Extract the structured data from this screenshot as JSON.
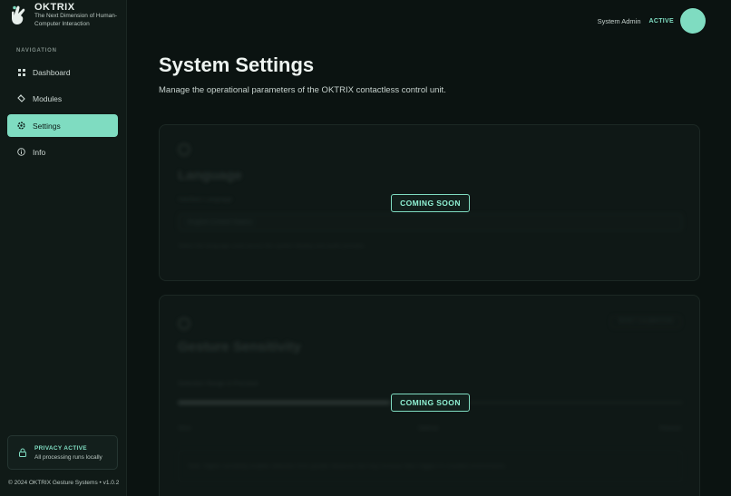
{
  "brand": {
    "name_part1": "OK",
    "name_part2": "TRIX",
    "tagline": "The Next Dimension of Human-Computer Interaction",
    "logo_icon": "hand-icon"
  },
  "sidebar": {
    "heading": "NAVIGATION",
    "items": [
      {
        "label": "Dashboard",
        "icon": "grid-icon",
        "active": false
      },
      {
        "label": "Modules",
        "icon": "puzzle-icon",
        "active": false
      },
      {
        "label": "Settings",
        "icon": "gear-icon",
        "active": true
      },
      {
        "label": "Info",
        "icon": "info-icon",
        "active": false
      }
    ],
    "privacy": {
      "title": "PRIVACY ACTIVE",
      "subtitle": "All processing runs locally",
      "icon": "lock-icon"
    },
    "footer": "© 2024 OKTRIX Gesture Systems • v1.0.2"
  },
  "topbar": {
    "user_name": "System Admin",
    "status": "ACTIVE"
  },
  "main": {
    "title": "System Settings",
    "description": "Manage the operational parameters of the OKTRIX contactless control unit."
  },
  "cards": [
    {
      "title": "Language",
      "field_label": "Interface Language",
      "select_value": "English (United States)",
      "help_text": "Select the language used across the system display and audio prompts.",
      "overlay": "COMING SOON"
    },
    {
      "title": "Gesture Sensitivity",
      "reset_label": "RESET CALIBRATION",
      "field_label": "Detection Range & Precision",
      "slider_fraction": 0.42,
      "slider_labels": [
        "Strict",
        "Optimal",
        "Relaxed"
      ],
      "note": "Note: Higher sensitivity enables detection from greater distances but may increase false triggers in crowded environments.",
      "overlay": "COMING SOON"
    }
  ],
  "colors": {
    "accent": "#7fdcc1",
    "background": "#0b1311",
    "sidebar": "#101a17"
  }
}
